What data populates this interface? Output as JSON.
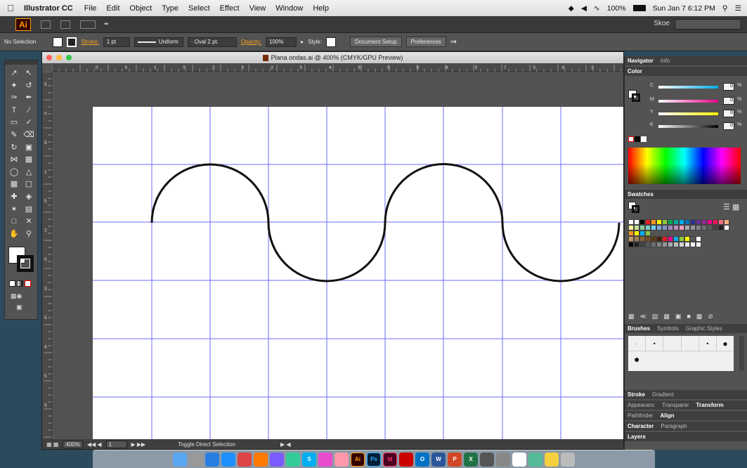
{
  "menubar": {
    "app_name": "Illustrator CC",
    "menus": [
      "File",
      "Edit",
      "Object",
      "Type",
      "Select",
      "Effect",
      "View",
      "Window",
      "Help"
    ],
    "battery": "100%",
    "datetime": "Sun Jan 7  6:12 PM"
  },
  "appbar": {
    "logo": "Ai",
    "workspace": "Skoe"
  },
  "control": {
    "selection": "No Selection",
    "stroke_label": "Stroke:",
    "stroke_value": "1 pt",
    "profile": "Uniform",
    "brush": "Oval 2 pt.",
    "opacity_label": "Opacity:",
    "opacity_value": "100%",
    "style_label": "Style:",
    "doc_setup": "Document Setup",
    "preferences": "Preferences"
  },
  "document": {
    "title": "Plana ondas.ai @ 400% (CMYK/GPU Preview)",
    "zoom": "400%",
    "page": "1",
    "status": "Toggle Direct Selection",
    "ruler_h": [
      "0",
      "5",
      "1",
      "5",
      "2",
      "5",
      "3",
      "5",
      "4",
      "5",
      "5",
      "5",
      "6",
      "5",
      "7",
      "5",
      "8",
      "5"
    ],
    "ruler_v": [
      "5",
      "0",
      "5",
      "1",
      "5",
      "2",
      "5",
      "3",
      "5",
      "4",
      "5",
      "5"
    ]
  },
  "panels": {
    "tab_navigator": "Navigator",
    "tab_info": "Info",
    "color_title": "Color",
    "channels": [
      {
        "label": "C",
        "value": "0",
        "unit": "%"
      },
      {
        "label": "M",
        "value": "0",
        "unit": "%"
      },
      {
        "label": "Y",
        "value": "0",
        "unit": "%"
      },
      {
        "label": "K",
        "value": "0",
        "unit": "%"
      }
    ],
    "swatches_title": "Swatches",
    "brushes_tabs": [
      "Brushes",
      "Symbols",
      "Graphic Styles"
    ],
    "stroke_tabs": [
      "Stroke",
      "Gradient"
    ],
    "appearance_tabs": [
      "Appearanc",
      "Transparer",
      "Transform"
    ],
    "pathfinder_tabs": [
      "Pathfinder",
      "Align"
    ],
    "character_tabs": [
      "Character",
      "Paragraph"
    ],
    "layers_title": "Layers"
  },
  "dock": {
    "apps": [
      "Finder",
      "Launchpad",
      "Safari",
      "App Store",
      "Chrome",
      "Firefox",
      "Siri",
      "Maps",
      "Skype",
      "iTunes",
      "Photos",
      "Ai",
      "Ps",
      "Id",
      "Acrobat",
      "Outlook",
      "Word",
      "PowerPoint",
      "Excel",
      "Photo Booth",
      "System Preferences",
      "Calendar",
      "Preview",
      "Notes",
      "Trash"
    ]
  },
  "colors": {
    "accent_orange": "#f7a021",
    "wave": "#111111",
    "grid": "#6b6bff"
  }
}
